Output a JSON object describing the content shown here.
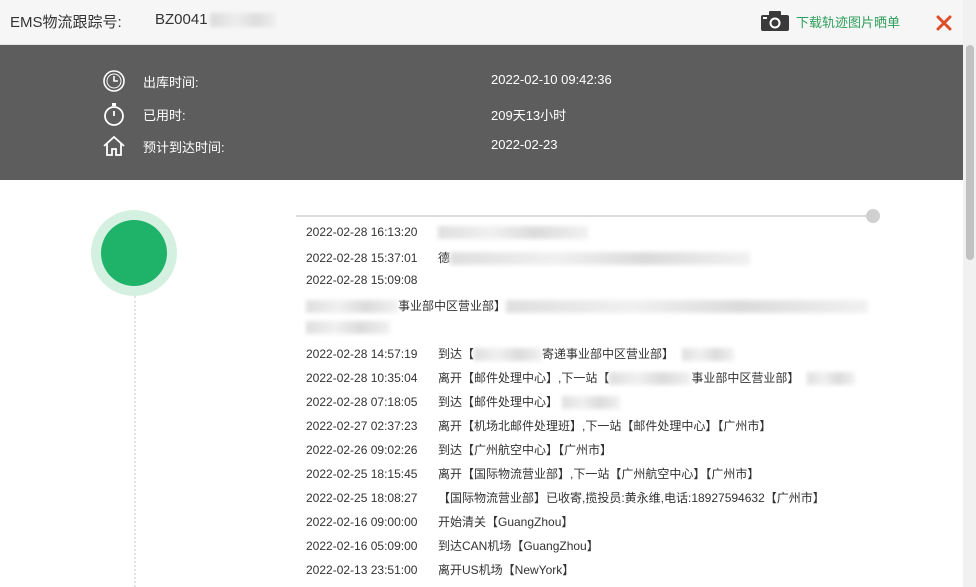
{
  "header": {
    "label": "EMS物流跟踪号:",
    "tracking_prefix": "BZ0041",
    "download_label": "下载轨迹图片晒单"
  },
  "summary": {
    "rows": [
      {
        "icon": "clock-icon",
        "label": "出库时间:",
        "value": "2022-02-10 09:42:36"
      },
      {
        "icon": "stopwatch-icon",
        "label": "已用时:",
        "value": "209天13小时"
      },
      {
        "icon": "home-icon",
        "label": "预计到达时间:",
        "value": "2022-02-23"
      }
    ]
  },
  "events": [
    {
      "time": "2022-02-28 16:13:20",
      "desc": ""
    },
    {
      "time": "2022-02-28 15:37:01",
      "desc": "德"
    },
    {
      "time": "2022-02-28 15:09:08",
      "desc": ""
    },
    {
      "time": "2022-02-28 14:57:19",
      "desc": "到达【",
      "desc2": "寄递事业部中区营业部】"
    },
    {
      "time": "2022-02-28 10:35:04",
      "desc": "离开【邮件处理中心】,下一站【",
      "desc2": "事业部中区营业部】"
    },
    {
      "time": "2022-02-28 07:18:05",
      "desc": "到达【邮件处理中心】"
    },
    {
      "time": "2022-02-27 02:37:23",
      "desc": "离开【机场北邮件处理班】,下一站【邮件处理中心】【广州市】"
    },
    {
      "time": "2022-02-26 09:02:26",
      "desc": "到达【广州航空中心】【广州市】"
    },
    {
      "time": "2022-02-25 18:15:45",
      "desc": "离开【国际物流营业部】,下一站【广州航空中心】【广州市】"
    },
    {
      "time": "2022-02-25 18:08:27",
      "desc": "【国际物流营业部】已收寄,揽投员:黄永维,电话:18927594632【广州市】"
    },
    {
      "time": "2022-02-16 09:00:00",
      "desc": "开始清关【GuangZhou】"
    },
    {
      "time": "2022-02-16 05:09:00",
      "desc": "到达CAN机场【GuangZhou】"
    },
    {
      "time": "2022-02-13 23:51:00",
      "desc": "离开US机场【NewYork】"
    }
  ],
  "event_wrap_text": "事业部中区营业部】",
  "colors": {
    "summary_bg": "#5d5d5d",
    "accent_green": "#1fb36a",
    "download_green": "#2e9e5b",
    "close_red": "#e04b2a"
  }
}
